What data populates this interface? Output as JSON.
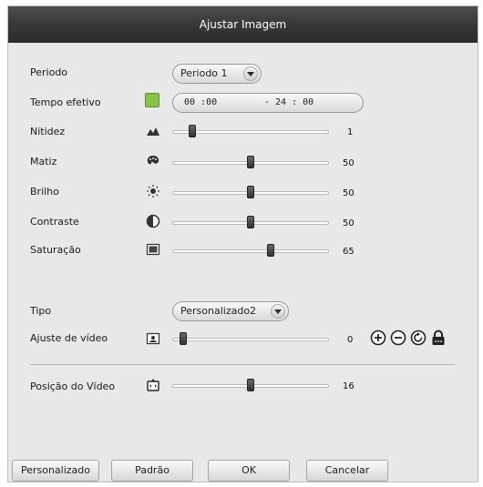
{
  "window": {
    "title": "Ajustar Imagem"
  },
  "rows": {
    "periodo": {
      "label": "Periodo",
      "value": "Periodo 1"
    },
    "tempo": {
      "label": "Tempo efetivo",
      "start": "00 :00",
      "end": "- 24 : 00",
      "enabled_color": "#8ac249"
    },
    "nitidez": {
      "label": "Nitidez",
      "value": "1",
      "icon": "mountain-icon",
      "level_percent": 7
    },
    "matiz": {
      "label": "Matiz",
      "value": "50",
      "icon": "palette-icon",
      "level_percent": 50
    },
    "brilho": {
      "label": "Brilho",
      "value": "50",
      "icon": "sun-icon",
      "level_percent": 50
    },
    "contraste": {
      "label": "Contraste",
      "value": "50",
      "icon": "contrast-icon",
      "level_percent": 50
    },
    "saturacao": {
      "label": "Saturação",
      "value": "65",
      "icon": "saturation-icon",
      "level_percent": 65
    },
    "tipo": {
      "label": "Tipo",
      "value": "Personalizado2"
    },
    "ajuste": {
      "label": "Ajuste de vídeo",
      "value": "0",
      "icon": "picture-icon",
      "level_percent": 0
    },
    "posicao": {
      "label": "Posição do Vídeo",
      "value": "16",
      "icon": "move-icon",
      "level_percent": 50
    }
  },
  "toolbar_icons": [
    "zoom-in-icon",
    "zoom-out-icon",
    "reset-icon",
    "lock-icon"
  ],
  "buttons": {
    "personalizado": "Personalizado",
    "padrao": "Padrão",
    "ok": "OK",
    "cancelar": "Cancelar"
  },
  "colors": {
    "titlebar": "#3a3a3a",
    "panel": "#e8e8e8",
    "slider_thumb": "#333333"
  }
}
